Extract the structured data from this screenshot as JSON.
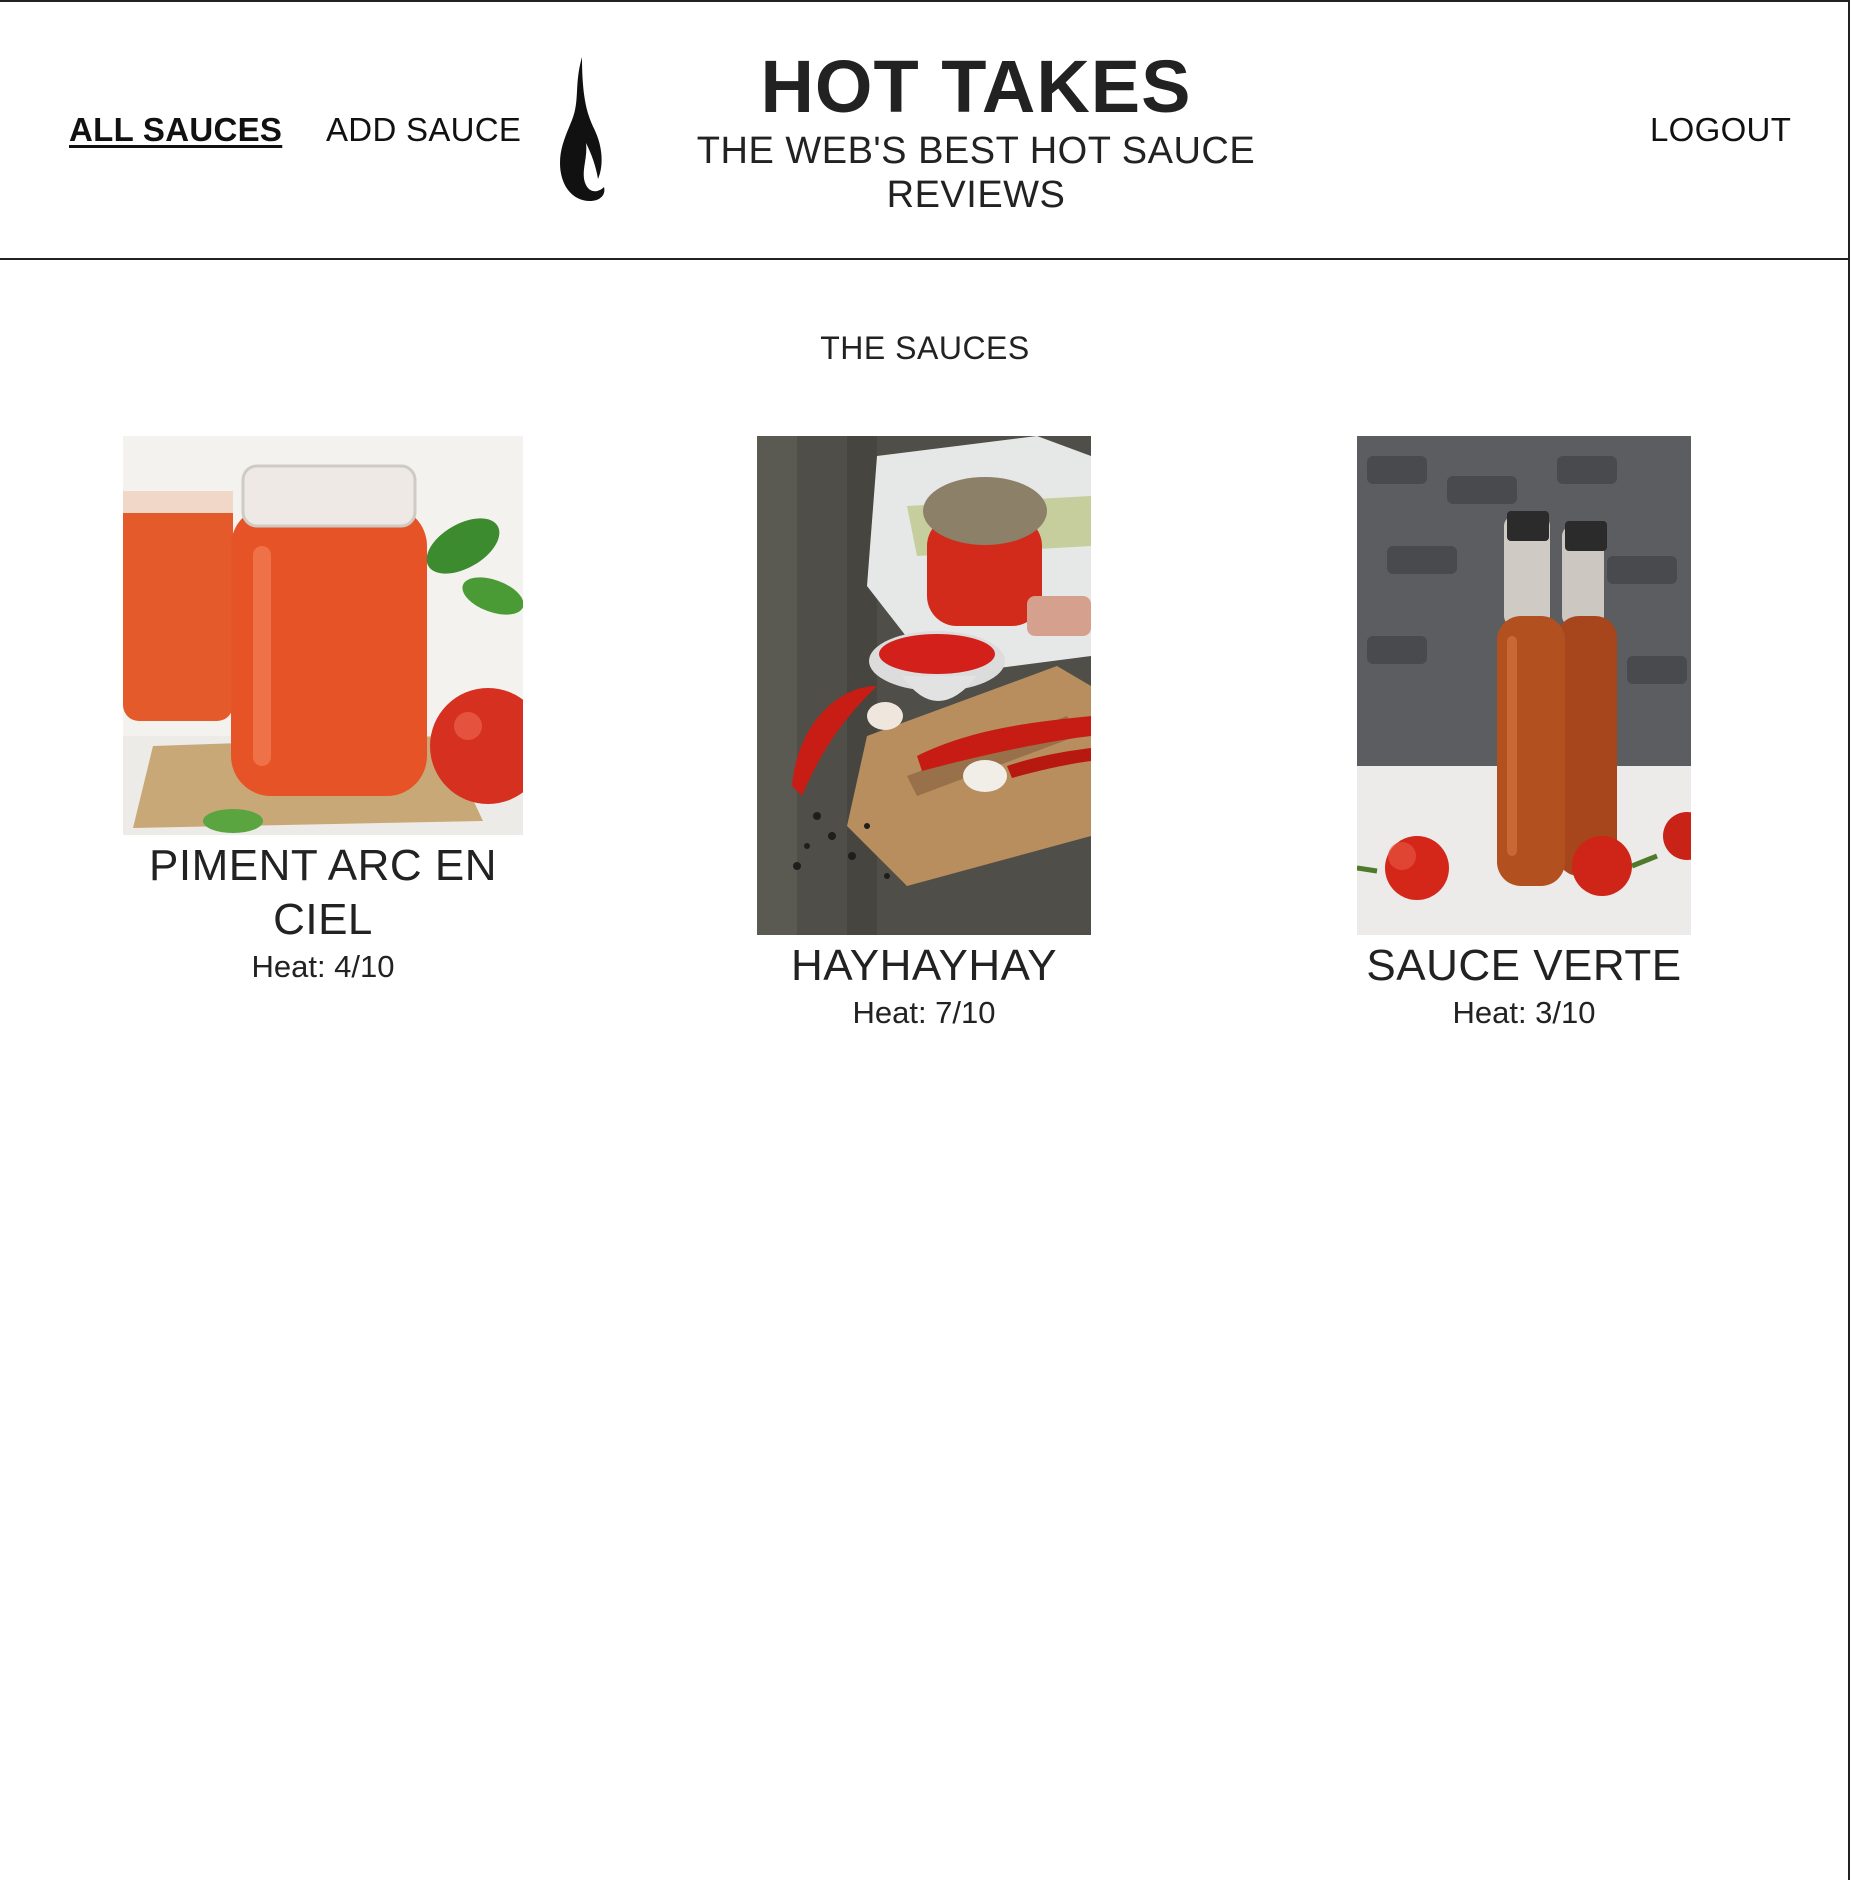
{
  "nav": {
    "all_sauces": "ALL SAUCES",
    "add_sauce": "ADD SAUCE",
    "logout": "LOGOUT"
  },
  "brand": {
    "title": "HOT TAKES",
    "subtitle": "THE WEB'S BEST HOT SAUCE REVIEWS"
  },
  "main": {
    "section_title": "THE SAUCES",
    "sauces": [
      {
        "name": "PIMENT ARC EN CIEL",
        "heat": "Heat: 4/10"
      },
      {
        "name": "HAYHAYHAY",
        "heat": "Heat: 7/10"
      },
      {
        "name": "SAUCE VERTE",
        "heat": "Heat: 3/10"
      }
    ]
  }
}
